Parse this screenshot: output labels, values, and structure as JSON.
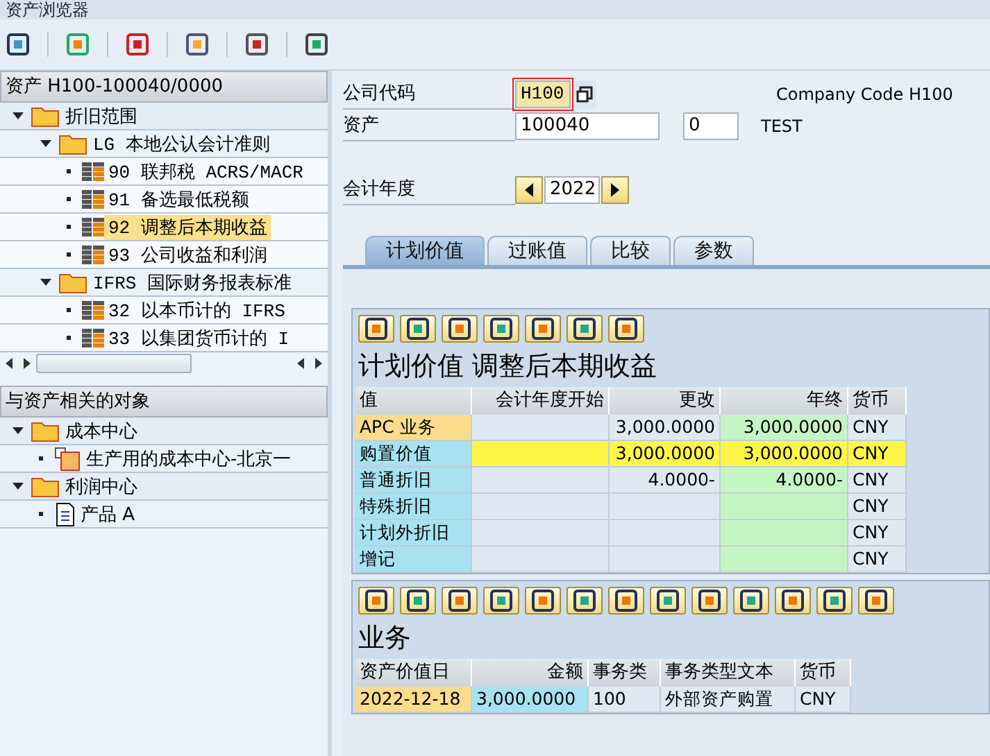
{
  "window": {
    "title": "资产浏览器"
  },
  "asset_tree": {
    "header": "资产 H100-100040/0000",
    "items": [
      {
        "kind": "folder",
        "label": "折旧范围",
        "expanded": true,
        "selected": false,
        "children": [
          {
            "kind": "folder",
            "label": "LG 本地公认会计准则",
            "expanded": true,
            "selected": false,
            "children": [
              {
                "kind": "area",
                "label": "90 联邦税 ACRS/MACR",
                "selected": false
              },
              {
                "kind": "area",
                "label": "91 备选最低税额",
                "selected": false
              },
              {
                "kind": "area",
                "label": "92 调整后本期收益",
                "selected": true
              },
              {
                "kind": "area",
                "label": "93 公司收益和利润",
                "selected": false
              }
            ]
          },
          {
            "kind": "folder",
            "label": "IFRS 国际财务报表标准",
            "expanded": true,
            "selected": false,
            "children": [
              {
                "kind": "area",
                "label": "32 以本币计的 IFRS",
                "selected": false
              },
              {
                "kind": "area",
                "label": "33 以集团货币计的 I",
                "selected": false
              }
            ]
          }
        ]
      }
    ]
  },
  "objects_tree": {
    "header": "与资产相关的对象",
    "items": [
      {
        "kind": "folder",
        "label": "成本中心",
        "expanded": true,
        "selected": false,
        "children": [
          {
            "kind": "cost_center",
            "label": "生产用的成本中心-北京一",
            "selected": false
          }
        ]
      },
      {
        "kind": "folder",
        "label": "利润中心",
        "expanded": true,
        "selected": false,
        "children": [
          {
            "kind": "document",
            "label": "产品 A",
            "selected": false
          }
        ]
      }
    ]
  },
  "form": {
    "company_code": {
      "label": "公司代码",
      "value": "H100",
      "description": "Company Code H100"
    },
    "asset": {
      "label": "资产",
      "value": "100040",
      "sub_value": "0",
      "description": "TEST"
    },
    "fiscal_year": {
      "label": "会计年度",
      "value": "2022"
    }
  },
  "tabs": [
    {
      "label": "计划价值",
      "selected": true
    },
    {
      "label": "过账值",
      "selected": false
    },
    {
      "label": "比较",
      "selected": false
    },
    {
      "label": "参数",
      "selected": false
    }
  ],
  "plan_grid": {
    "title": "计划价值 调整后本期收益",
    "columns": [
      {
        "label": "值",
        "kind": "key"
      },
      {
        "label": "会计年度开始",
        "kind": "amount"
      },
      {
        "label": "更改",
        "kind": "amount"
      },
      {
        "label": "年终",
        "kind": "total"
      },
      {
        "label": "货币",
        "kind": "text"
      }
    ],
    "rows": [
      {
        "selected": true,
        "highlighted": false,
        "cells": [
          "APC 业务",
          "",
          "3,000.0000",
          "3,000.0000",
          "CNY"
        ]
      },
      {
        "selected": false,
        "highlighted": true,
        "cells": [
          "购置价值",
          "",
          "3,000.0000",
          "3,000.0000",
          "CNY"
        ]
      },
      {
        "selected": false,
        "highlighted": false,
        "cells": [
          "普通折旧",
          "",
          "4.0000-",
          "4.0000-",
          "CNY"
        ]
      },
      {
        "selected": false,
        "highlighted": false,
        "cells": [
          "特殊折旧",
          "",
          "",
          "",
          "CNY"
        ]
      },
      {
        "selected": false,
        "highlighted": false,
        "cells": [
          "计划外折旧",
          "",
          "",
          "",
          "CNY"
        ]
      },
      {
        "selected": false,
        "highlighted": false,
        "cells": [
          "增记",
          "",
          "",
          "",
          "CNY"
        ]
      }
    ]
  },
  "business_grid": {
    "title": "业务",
    "columns": [
      {
        "label": "资产价值日",
        "kind": "key"
      },
      {
        "label": "金额",
        "kind": "key_amount"
      },
      {
        "label": "事务类",
        "kind": "text"
      },
      {
        "label": "事务类型文本",
        "kind": "text"
      },
      {
        "label": "货币",
        "kind": "text"
      }
    ],
    "rows": [
      {
        "selected": true,
        "highlighted": false,
        "cells": [
          "2022-12-18",
          "3,000.0000",
          "100",
          "外部资产购置",
          "CNY"
        ]
      }
    ]
  }
}
